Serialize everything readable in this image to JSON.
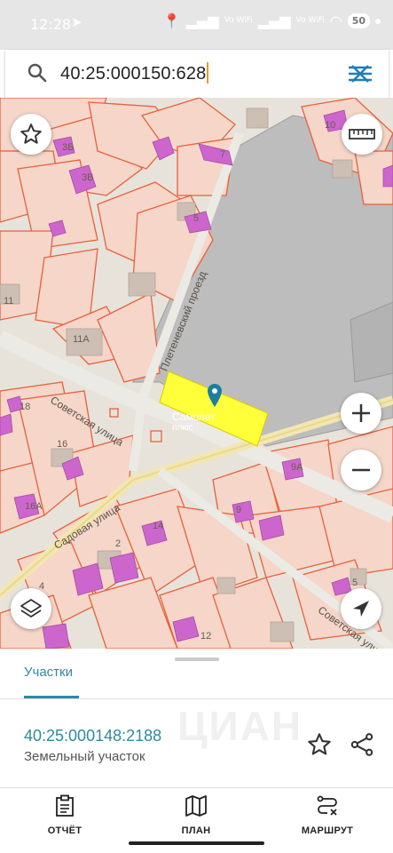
{
  "status_bar": {
    "time": "12:28",
    "battery": "50",
    "wifi_label_1": "Vo WiFi",
    "wifi_label_2": "Vo WiFi"
  },
  "search": {
    "value": "40:25:000150:628"
  },
  "map": {
    "labels": [
      "3Б",
      "3В",
      "7",
      "5",
      "10",
      "11",
      "11А",
      "18",
      "16",
      "16А",
      "9А",
      "9",
      "14",
      "2",
      "4",
      "12",
      "5",
      "Самолет",
      "плюс"
    ],
    "streets": {
      "proezd": "Плетеневский проезд",
      "sovetskaya": "Советская улица",
      "sadovaya": "Садовая улица",
      "sovetskaya_2": "Советская улица"
    },
    "highlight_color": "#ffff3a",
    "parcel_fill": "#f5d6c9",
    "parcel_border": "#e8603c",
    "building_color": "#cc66cc"
  },
  "sheet": {
    "tab": "Участки",
    "parcel_number": "40:25:000148:2188",
    "parcel_type": "Земельный участок",
    "watermark": "ЦИАН"
  },
  "nav": {
    "report": "ОТЧЁТ",
    "plan": "ПЛАН",
    "route": "МАРШРУТ"
  },
  "colors": {
    "accent": "#2d8aa0"
  }
}
